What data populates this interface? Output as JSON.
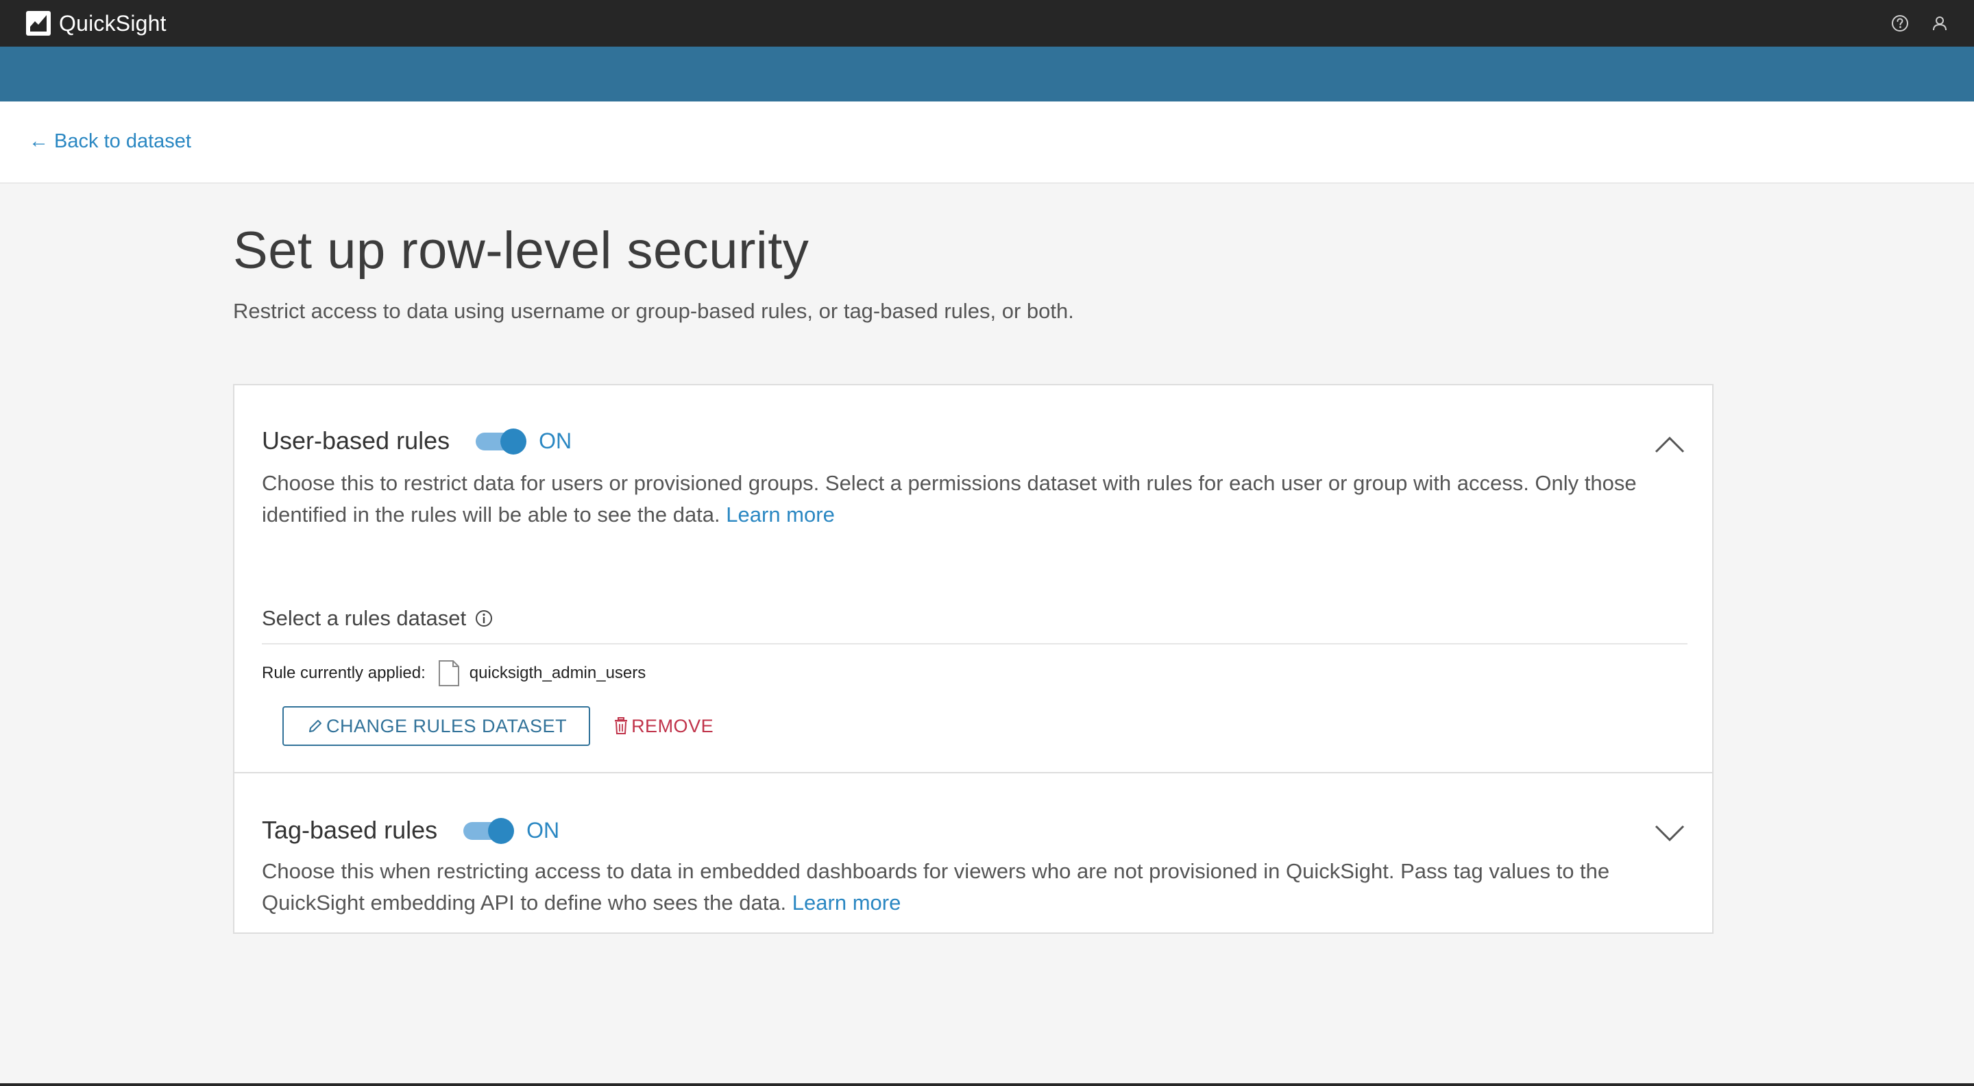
{
  "app": {
    "title": "QuickSight"
  },
  "nav": {
    "back_label": "← Back to dataset"
  },
  "page": {
    "title": "Set up row-level security",
    "subtitle": "Restrict access to data using username or group-based rules, or tag-based rules, or both."
  },
  "user_rules": {
    "title": "User-based rules",
    "toggle_state": "ON",
    "description": "Choose this to restrict data for users or provisioned groups. Select a permissions dataset with rules for each user or group with access. Only those identified in the rules will be able to see the data.",
    "learn_more": "Learn more",
    "select_label": "Select a rules dataset",
    "applied_label": "Rule currently applied:",
    "applied_dataset": "quicksigth_admin_users",
    "change_button": "CHANGE RULES DATASET",
    "remove_button": "REMOVE"
  },
  "tag_rules": {
    "title": "Tag-based rules",
    "toggle_state": "ON",
    "description": "Choose this when restricting access to data in embedded dashboards for viewers who are not provisioned in QuickSight. Pass tag values to the QuickSight embedding API to define who sees the data.",
    "learn_more": "Learn more"
  },
  "icons": {
    "logo": "quicksight-logo-icon",
    "help": "help-circle-icon",
    "user": "user-profile-icon",
    "info": "info-icon",
    "document": "document-icon",
    "edit": "pencil-icon",
    "delete": "trash-icon",
    "collapse": "chevron-up-icon",
    "expand": "chevron-down-icon"
  },
  "colors": {
    "topbar": "#262626",
    "brand_bar": "#317299",
    "link": "#2a87c2",
    "danger": "#c0334a",
    "toggle_track": "#7db5e0"
  }
}
